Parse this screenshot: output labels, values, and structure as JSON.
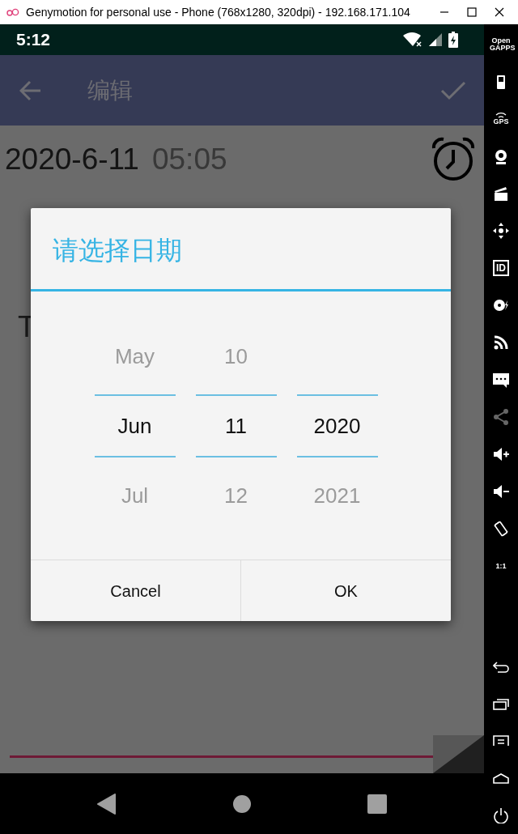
{
  "window": {
    "title": "Genymotion for personal use - Phone (768x1280, 320dpi) - 192.168.171.104"
  },
  "status_bar": {
    "time": "5:12"
  },
  "toolbar": {
    "title": "编辑"
  },
  "content": {
    "date": "2020-6-11",
    "time": "05:05",
    "partial_text": "T"
  },
  "dialog": {
    "title": "请选择日期",
    "pickers": [
      {
        "items": [
          {
            "label": "May",
            "selected": false
          },
          {
            "label": "Jun",
            "selected": true
          },
          {
            "label": "Jul",
            "selected": false
          }
        ]
      },
      {
        "items": [
          {
            "label": "10",
            "selected": false
          },
          {
            "label": "11",
            "selected": true
          },
          {
            "label": "12",
            "selected": false
          }
        ]
      },
      {
        "items": [
          {
            "label": "2020",
            "selected": true
          },
          {
            "label": "2021",
            "selected": false
          }
        ]
      }
    ],
    "buttons": [
      {
        "label": "Cancel"
      },
      {
        "label": "OK"
      }
    ]
  },
  "sidebar": {
    "items": [
      {
        "kind": "gapps",
        "label": "Open GAPPS",
        "disabled": false
      },
      {
        "kind": "battery",
        "disabled": false
      },
      {
        "kind": "gps",
        "label": "GPS",
        "disabled": false
      },
      {
        "kind": "webcam",
        "disabled": false
      },
      {
        "kind": "clapper",
        "disabled": false
      },
      {
        "kind": "dpad",
        "disabled": false
      },
      {
        "kind": "id",
        "label": "ID",
        "disabled": false
      },
      {
        "kind": "disk",
        "disabled": false
      },
      {
        "kind": "rss",
        "disabled": false
      },
      {
        "kind": "chat",
        "disabled": false
      },
      {
        "kind": "share",
        "disabled": true
      },
      {
        "kind": "volup",
        "disabled": false
      },
      {
        "kind": "voldown",
        "disabled": false
      },
      {
        "kind": "rotate",
        "disabled": false
      },
      {
        "kind": "scale",
        "label": "1:1",
        "disabled": false
      }
    ],
    "device_buttons": [
      {
        "kind": "back"
      },
      {
        "kind": "recent"
      },
      {
        "kind": "menu"
      },
      {
        "kind": "home"
      },
      {
        "kind": "power"
      }
    ]
  }
}
